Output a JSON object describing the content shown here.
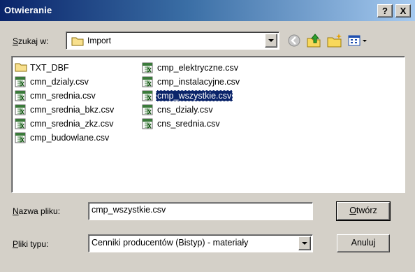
{
  "window": {
    "title": "Otwieranie",
    "help_button": "?",
    "close_button": "X"
  },
  "look_in": {
    "label_underlined": "S",
    "label_rest": "zukaj w:",
    "value": "Import"
  },
  "toolbar": {
    "icons": [
      "back-icon",
      "up-folder-icon",
      "new-folder-icon",
      "view-menu-icon"
    ]
  },
  "files": {
    "column1": [
      {
        "name": "TXT_DBF",
        "type": "folder"
      },
      {
        "name": "cmn_dzialy.csv",
        "type": "csv"
      },
      {
        "name": "cmn_srednia.csv",
        "type": "csv"
      },
      {
        "name": "cmn_srednia_bkz.csv",
        "type": "csv"
      },
      {
        "name": "cmn_srednia_zkz.csv",
        "type": "csv"
      },
      {
        "name": "cmp_budowlane.csv",
        "type": "csv"
      }
    ],
    "column2": [
      {
        "name": "cmp_elektryczne.csv",
        "type": "csv"
      },
      {
        "name": "cmp_instalacyjne.csv",
        "type": "csv"
      },
      {
        "name": "cmp_wszystkie.csv",
        "type": "csv",
        "selected": true
      },
      {
        "name": "cns_dzialy.csv",
        "type": "csv"
      },
      {
        "name": "cns_srednia.csv",
        "type": "csv"
      }
    ]
  },
  "filename": {
    "label_underlined": "N",
    "label_rest": "azwa pliku:",
    "value": "cmp_wszystkie.csv"
  },
  "filetype": {
    "label_underlined": "P",
    "label_rest": "liki typu:",
    "value": "Cenniki producentów (Bistyp) - materiały"
  },
  "buttons": {
    "open_underlined": "O",
    "open_rest": "twórz",
    "cancel": "Anuluj"
  },
  "colors": {
    "title_gradient_start": "#0a246a",
    "title_gradient_end": "#a6caf0",
    "selection": "#0a246a",
    "dialog_face": "#d4d0c8"
  }
}
